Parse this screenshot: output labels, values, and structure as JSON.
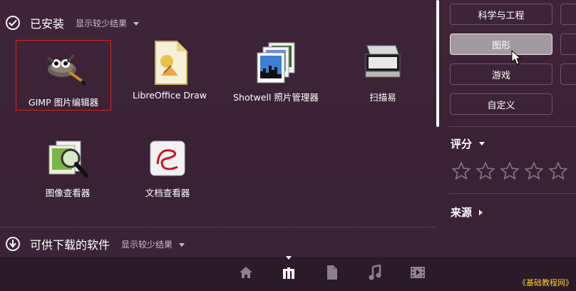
{
  "installed": {
    "title": "已安装",
    "toggle": "显示较少结果",
    "apps": [
      {
        "label": "GIMP 图片编辑器",
        "icon": "gimp-icon"
      },
      {
        "label": "LibreOffice Draw",
        "icon": "libreoffice-draw-icon"
      },
      {
        "label": "Shotwell 照片管理器",
        "icon": "shotwell-icon"
      },
      {
        "label": "扫描易",
        "icon": "scanner-icon"
      },
      {
        "label": "图像查看器",
        "icon": "image-viewer-icon"
      },
      {
        "label": "文档查看器",
        "icon": "document-viewer-icon"
      }
    ]
  },
  "available": {
    "title": "可供下载的软件",
    "toggle": "显示较少结果"
  },
  "filters": {
    "categories": [
      "科学与工程",
      "图形",
      "游戏",
      "自定义"
    ],
    "active_category": "图形",
    "rating_title": "评分",
    "rating_stars": 5,
    "source_title": "来源"
  },
  "lenses": [
    "home-lens-icon",
    "applications-lens-icon",
    "files-lens-icon",
    "music-lens-icon",
    "video-lens-icon"
  ],
  "active_lens": "applications-lens-icon",
  "watermark": "《基础教程网》",
  "colors": {
    "background": "#3b2436",
    "selection_border": "#d8221c",
    "active_button": "#a29aa0",
    "watermark": "#f4d12a"
  }
}
